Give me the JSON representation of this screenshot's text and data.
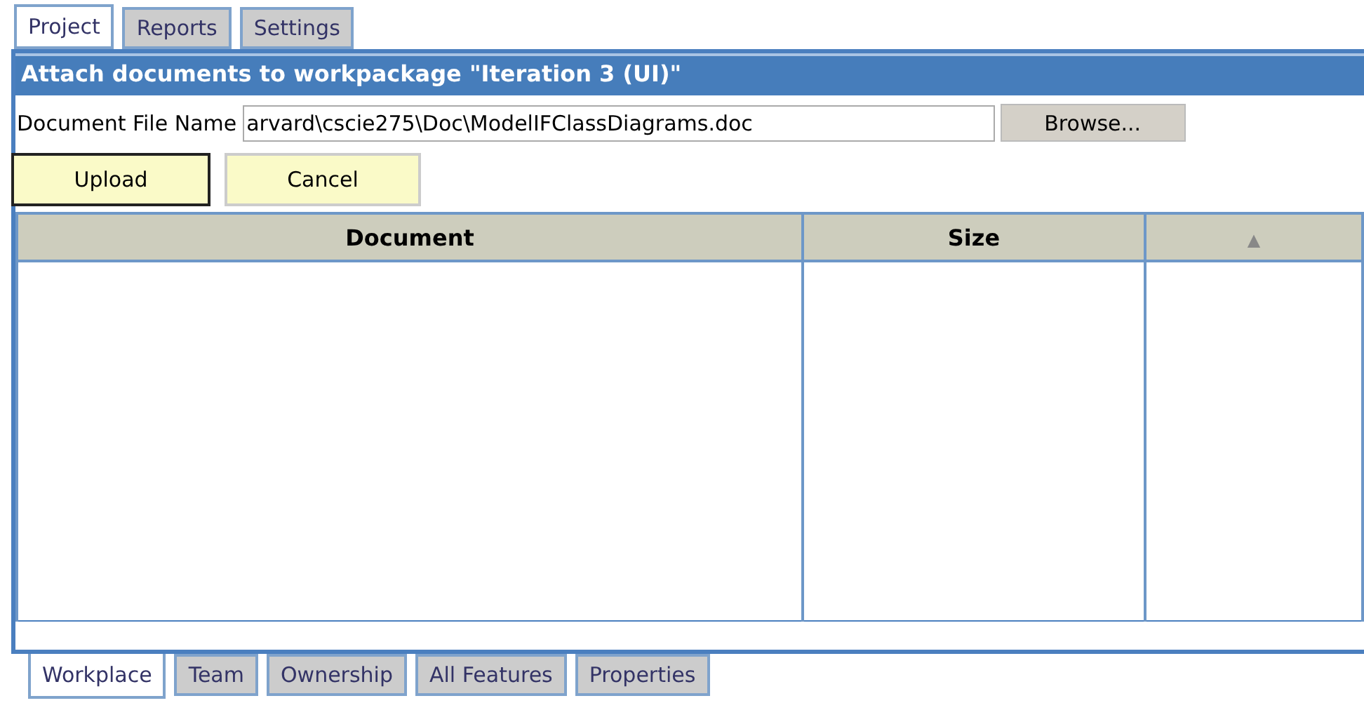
{
  "top_tabs": [
    {
      "label": "Project",
      "selected": true
    },
    {
      "label": "Reports",
      "selected": false
    },
    {
      "label": "Settings",
      "selected": false
    }
  ],
  "panel": {
    "title": "Attach documents to workpackage \"Iteration 3 (UI)\"",
    "file_field": {
      "label": "Document File Name",
      "value": "arvard\\cscie275\\Doc\\ModelIFClassDiagrams.doc",
      "browse": "Browse..."
    },
    "buttons": [
      {
        "label": "Upload",
        "focused": true
      },
      {
        "label": "Cancel",
        "focused": false
      }
    ],
    "table": {
      "columns": [
        {
          "label": "Document",
          "kind": "text"
        },
        {
          "label": "Size",
          "kind": "text"
        },
        {
          "label": "▲",
          "kind": "sort"
        }
      ]
    }
  },
  "bottom_tabs": [
    {
      "label": "Workplace",
      "selected": true
    },
    {
      "label": "Team",
      "selected": false
    },
    {
      "label": "Ownership",
      "selected": false
    },
    {
      "label": "All Features",
      "selected": false
    },
    {
      "label": "Properties",
      "selected": false
    }
  ]
}
